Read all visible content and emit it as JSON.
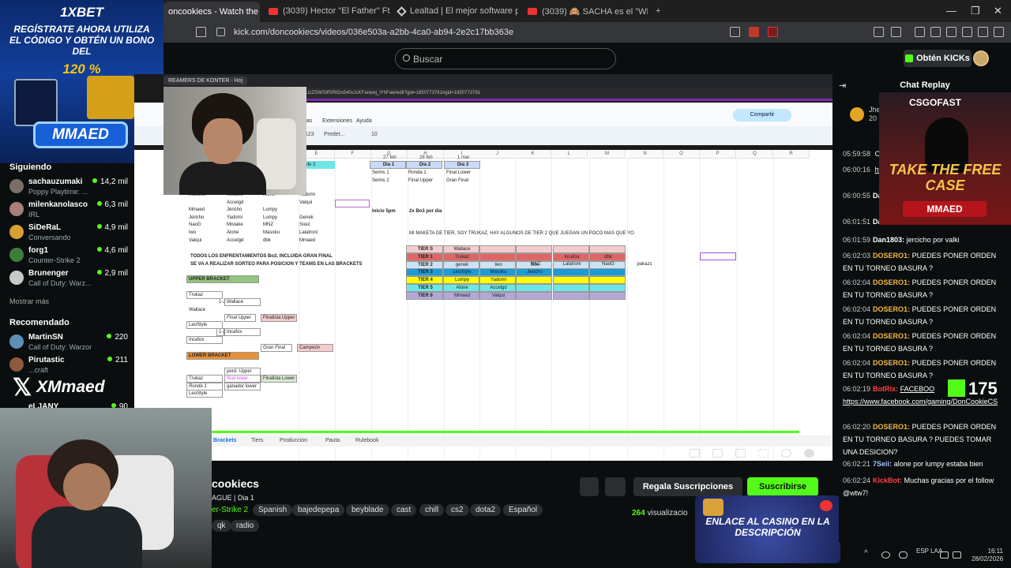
{
  "browser": {
    "tabs": [
      {
        "title": "oncookiecs - Watch the VOD",
        "active": true
      },
      {
        "title": "(3039) Hector \"El Father\" Ft. Wise - S",
        "active": false
      },
      {
        "title": "Lealtad | El mejor software para pote",
        "active": false
      },
      {
        "title": "(3039) 🙈 SACHA es el \"WESTCOL de",
        "active": false
      }
    ],
    "new_tab": "+",
    "url": "kick.com/doncookiecs/videos/036e503a-a2bb-4ca0-ab94-2e2c17bb363e"
  },
  "header": {
    "search_placeholder": "Buscar",
    "kicks_button": "Obtén KICKs"
  },
  "sidebar": {
    "following_title": "Siguiendo",
    "following": [
      {
        "name": "sachauzumaki",
        "game": "Poppy Playtime: ...",
        "viewers": "14,2 mil",
        "color": "#7a6f66"
      },
      {
        "name": "milenkanolasco",
        "game": "IRL",
        "viewers": "6,3 mil",
        "color": "#a87f7a"
      },
      {
        "name": "SiDeRaL",
        "game": "Conversando",
        "viewers": "4,9 mil",
        "color": "#d6a032"
      },
      {
        "name": "forg1",
        "game": "Counter-Strike 2",
        "viewers": "4,6 mil",
        "color": "#3c7d3a"
      },
      {
        "name": "Brunenger",
        "game": "Call of Duty: Warz...",
        "viewers": "2,9 mil",
        "color": "#c9c9c9"
      }
    ],
    "show_more": "Mostrar más",
    "recommended_title": "Recomendado",
    "recommended": [
      {
        "name": "MartinSN",
        "game": "Call of Duty: Warzone",
        "viewers": "220",
        "color": "#5e8fb7"
      },
      {
        "name": "Pirutastic",
        "game": "...craft",
        "viewers": "211",
        "color": "#8c5a3c"
      },
      {
        "name": "eLJANY",
        "game": "",
        "viewers": "90",
        "color": "#555"
      }
    ]
  },
  "ads": {
    "xbet_logo": "1XBET",
    "xbet_promo": "REGÍSTRATE AHORA UTILIZA EL CÓDIGO Y OBTÉN UN BONO DEL",
    "xbet_pct": "120 %",
    "xbet_code": "MMAED",
    "xmmaed": "XMmaed",
    "csgofast_title": "CSGOFAST",
    "csgofast_promo": "TAKE THE FREE CASE",
    "csgofast_code": "MMAED",
    "casino": "ENLACE AL CASINO EN LA DESCRIPCIÓN",
    "kick_count": "175"
  },
  "sheet": {
    "inner_tab": "REAMERS DE KONTER - Hoj",
    "inner_url": "UzZSWS9fSRtOo540vJcKFanwej_lYhFaw/edit?gid=1850773781#gid=1850773781",
    "menu": [
      "Extensiones",
      "Ayuda"
    ],
    "menu_prefix": "ntas",
    "share": "Compartir",
    "font_name": "Predet...",
    "font_size": "10",
    "zoom": "123",
    "col_headers": [
      "E",
      "F",
      "G",
      "H",
      "I",
      "J",
      "K",
      "L",
      "M",
      "N",
      "O",
      "P",
      "Q",
      "R"
    ],
    "dates": [
      "27 feb",
      "28 feb",
      "1 mar"
    ],
    "days": [
      "Dia 1",
      "Dia 2",
      "Dia 3"
    ],
    "day_rows": [
      [
        "Semis 1",
        "Ronda 1",
        "Final Lower"
      ],
      [
        "Semis 2",
        "Final Upper",
        "Gran Final"
      ]
    ],
    "start": "Inicio 5pm",
    "format": "2x Bo3 por dia",
    "player_rows": [
      [
        "Masoku",
        "Mistake",
        "Alone",
        "Yadomi"
      ],
      [
        "",
        "Accelgd",
        "",
        "Valqui"
      ],
      [
        "Mmaed",
        "Jericho",
        "Lumpy",
        ""
      ],
      [
        "Jericho",
        "Yadomi",
        "Lumpy",
        "Genek"
      ],
      [
        "NaoG",
        "Mistake",
        "MNZ",
        "Soez"
      ],
      [
        "Iwo",
        "Alone",
        "Masoku",
        "Lalatroni"
      ],
      [
        "Valqui",
        "Accelgd",
        "dbk",
        "Mmaed"
      ]
    ],
    "first_cell_label": "Style 3",
    "tier_note": "MI MAKETA DE TIER, SOY TRUKAZ, HAY ALGUNOS DE TIER 2 QUE JUEGAN UN POCO MAS QUE YO",
    "tiers": [
      {
        "label": "TIER S",
        "players": [
          "Wallace"
        ],
        "color": "#f4cccc"
      },
      {
        "label": "TIER 1",
        "players": [
          "Trukaz",
          "",
          "",
          "Incafox",
          "dbk"
        ],
        "color": "#e06666"
      },
      {
        "label": "TIER 2",
        "players": [
          "genek",
          "Iwo",
          "Soe",
          "",
          ""
        ],
        "color": "#cfe2f3"
      },
      {
        "label": "TIER 3",
        "players": [
          "LeoStyle",
          "Masoku",
          "Jericho",
          "",
          ""
        ],
        "color": "#1c9bd6"
      },
      {
        "label": "TIER 4",
        "players": [
          "Lumpy",
          "Yadomi",
          "",
          "",
          ""
        ],
        "color": "#ffff00"
      },
      {
        "label": "TIER 5",
        "players": [
          "Alone",
          "Accelgd",
          "",
          "",
          ""
        ],
        "color": "#6fe6e6"
      },
      {
        "label": "TIER 6",
        "players": [
          "Mmaed",
          "Valqui",
          "",
          "",
          ""
        ],
        "color": "#b4a7d6"
      }
    ],
    "tier2_extra": [
      "MNZ",
      "Lalatroni",
      "NaoG",
      "pakazs"
    ],
    "rules_1": "TODOS LOS ENFRENTAMIENTOS Bo3, INCLUIDA GRAN FINAL",
    "rules_2": "SE VA A REALIZAR SORTEO PARA POSICION Y TEAMS EN LAS BRACKETS",
    "upper_bracket": "UPPER BRACKET",
    "lower_bracket": "LOWER BRACKET",
    "ub": [
      "Trukaz",
      "1-2",
      "Wallace",
      "Wallace",
      "Final Upper",
      "Finalista Upper",
      "LeoStyle",
      "1-2",
      "Incafox",
      "Incafox",
      "Gran Final",
      "Campeón"
    ],
    "lb": [
      "perd. Upper",
      "final lower",
      "Finalista Lower",
      "Trukaz",
      "Ronda 1",
      "ganador lower",
      "LeoStyle"
    ],
    "tabs": [
      "Brackets",
      "Tiers",
      "Produccion",
      "Pauta",
      "Rulebook"
    ]
  },
  "player": {
    "time": ":31 / 00:19:48"
  },
  "channel": {
    "name": "cookiecs",
    "league": "AGUE | Dia 1",
    "category": "er-Strike 2",
    "tags": [
      "Spanish",
      "bajedepepa",
      "beyblade",
      "cast",
      "chill",
      "cs2",
      "dota2",
      "Español",
      "qk",
      "radio"
    ],
    "viewers": "264",
    "viewers_label": "visualizacio",
    "gift_button": "Regala Suscripciones",
    "subscribe_button": "Suscribirse"
  },
  "chat": {
    "title": "Chat Replay",
    "partial_top": "Jhe 20",
    "messages": [
      {
        "ts": "05:59:58",
        "user": "",
        "ucls": "u4",
        "text": "O"
      },
      {
        "ts": "06:00:16",
        "user": "",
        "ucls": "u2",
        "text": "https://wwv",
        "link": true
      },
      {
        "ts": "06:00:55",
        "user": "Da",
        "ucls": "u2",
        "text": "equipo de i"
      },
      {
        "ts": "06:01:51",
        "user": "Dan",
        "ucls": "u2",
        "text": ""
      },
      {
        "ts": "06:01:59",
        "user": "Dan1803:",
        "ucls": "u2",
        "text": "jercicho por valki"
      },
      {
        "ts": "06:02:03",
        "user": "DOSERO1:",
        "ucls": "u1",
        "text": "PUEDES PONER ORDEN EN TU TORNEO BASURA ?"
      },
      {
        "ts": "06:02:04",
        "user": "DOSERO1:",
        "ucls": "u1",
        "text": "PUEDES PONER ORDEN EN TU TORNEO BASURA ?"
      },
      {
        "ts": "06:02:04",
        "user": "DOSERO1:",
        "ucls": "u1",
        "text": "PUEDES PONER ORDEN EN TU TORNEO BASURA ?"
      },
      {
        "ts": "06:02:04",
        "user": "DOSERO1:",
        "ucls": "u1",
        "text": "PUEDES PONER ORDEN EN TU TORNEO BASURA ?"
      },
      {
        "ts": "06:02:04",
        "user": "DOSERO1:",
        "ucls": "u1",
        "text": "PUEDES PONER ORDEN EN TU TORNEO BASURA ?"
      },
      {
        "ts": "06:02:19",
        "user": "BotRix:",
        "ucls": "u4",
        "text": "FACEBOO https://www.facebook.com/gaming/DonCookieCS",
        "link": true
      },
      {
        "ts": "06:02:20",
        "user": "DOSERO1:",
        "ucls": "u1",
        "text": "PUEDES PONER ORDEN EN TU TORNEO BASURA ? PUEDES TOMAR UNA DESICION?"
      },
      {
        "ts": "06:02:21",
        "user": "7Seii:",
        "ucls": "u3",
        "text": "alone por lumpy estaba bien"
      },
      {
        "ts": "06:02:24",
        "user": "KickBot:",
        "ucls": "u4",
        "text": "Muchas gracias por el follow @wtw7!"
      }
    ]
  },
  "taskbar": {
    "lang": "ESP LAA",
    "time": "16:11",
    "date": "28/02/2026"
  }
}
